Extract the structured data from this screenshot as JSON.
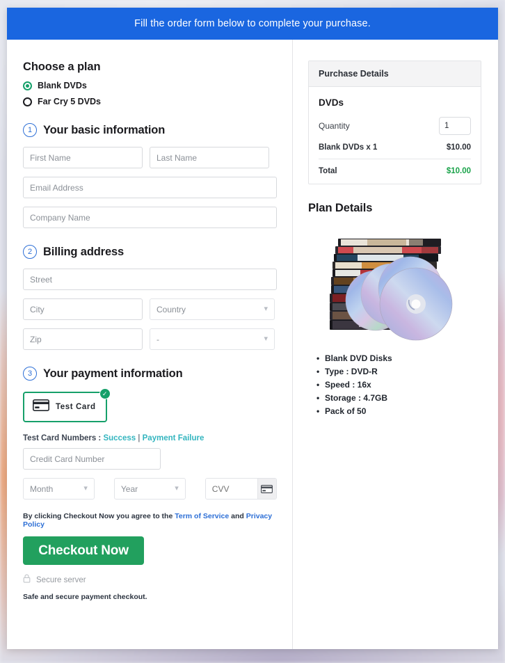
{
  "banner": {
    "text": "Fill the order form below to complete your purchase."
  },
  "colors": {
    "banner_blue": "#1a66e0",
    "accent_green": "#16a06a",
    "button_green": "#22a05e",
    "link_blue": "#2d6fd6",
    "link_teal": "#33b5bf",
    "total_green": "#1aa34a",
    "step_blue": "#2d6fd6"
  },
  "plan": {
    "title": "Choose a plan",
    "options": [
      {
        "label": "Blank DVDs",
        "selected": true
      },
      {
        "label": "Far Cry 5 DVDs",
        "selected": false
      }
    ]
  },
  "step1": {
    "number": "1",
    "title": "Your basic information",
    "fields": {
      "first_name": {
        "placeholder": "First Name",
        "value": ""
      },
      "last_name": {
        "placeholder": "Last Name",
        "value": ""
      },
      "email": {
        "placeholder": "Email Address",
        "value": ""
      },
      "company": {
        "placeholder": "Company Name",
        "value": ""
      }
    }
  },
  "step2": {
    "number": "2",
    "title": "Billing address",
    "fields": {
      "street": {
        "placeholder": "Street",
        "value": ""
      },
      "city": {
        "placeholder": "City",
        "value": ""
      },
      "country": {
        "selected": "Country"
      },
      "zip": {
        "placeholder": "Zip",
        "value": ""
      },
      "state": {
        "selected": "-"
      }
    }
  },
  "step3": {
    "number": "3",
    "title": "Your payment information",
    "method": {
      "label": "Test  Card",
      "selected": true,
      "icon": "credit-card-icon",
      "badge": "check-icon"
    },
    "test_numbers": {
      "prefix": "Test Card Numbers :",
      "success_link": "Success",
      "separator": "|",
      "failure_link": "Payment Failure"
    },
    "card_number": {
      "placeholder": "Credit Card Number",
      "value": ""
    },
    "month": {
      "selected": "Month"
    },
    "year": {
      "selected": "Year"
    },
    "cvv": {
      "placeholder": "CVV",
      "value": ""
    },
    "terms": {
      "prefix": "By clicking Checkout Now you agree to the",
      "tos_link": "Term of Service",
      "and": "and",
      "privacy_link": "Privacy Policy"
    },
    "checkout_button": "Checkout Now",
    "secure_server": "Secure server",
    "safe_note": "Safe and secure payment checkout."
  },
  "purchase": {
    "header": "Purchase Details",
    "product_title": "DVDs",
    "quantity_label": "Quantity",
    "quantity_value": "1",
    "line_item_label": "Blank DVDs x 1",
    "line_item_amount": "$10.00",
    "total_label": "Total",
    "total_amount": "$10.00"
  },
  "plan_details": {
    "title": "Plan Details",
    "image_alt": "stack-of-dvd-cases-and-discs",
    "bullets": [
      "Blank DVD Disks",
      "Type : DVD-R",
      "Speed : 16x",
      "Storage : 4.7GB",
      "Pack of 50"
    ]
  }
}
